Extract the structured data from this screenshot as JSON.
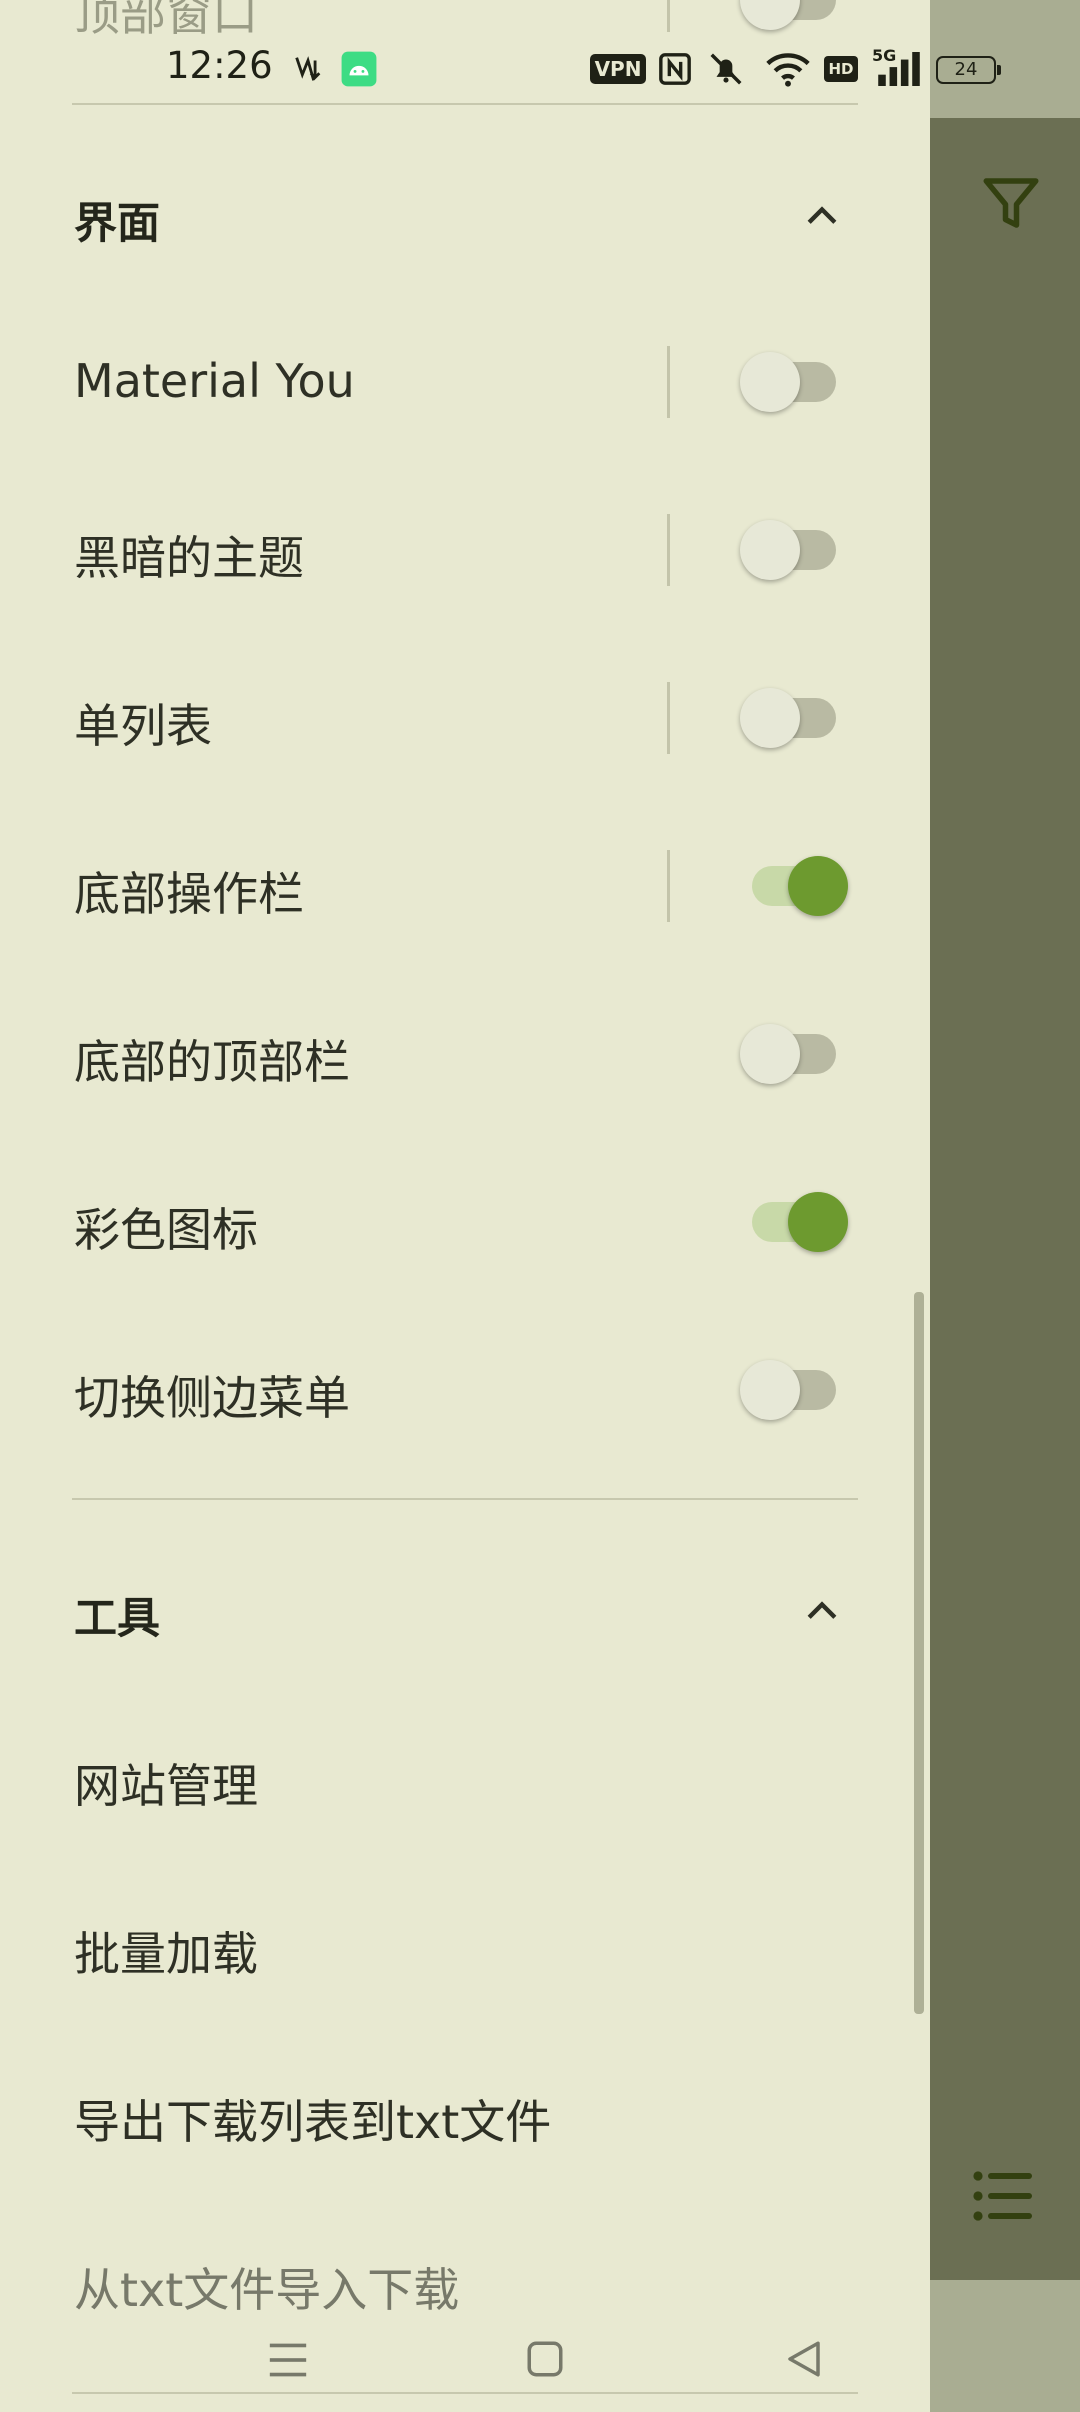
{
  "status_bar": {
    "time": "12:26",
    "vpn_badge": "VPN",
    "hd_badge": "HD",
    "network": "5G",
    "battery": "24"
  },
  "partial_top_label": "顶部窗口",
  "sections": {
    "interface": {
      "title": "界面",
      "items": [
        {
          "label": "Material You",
          "on": false
        },
        {
          "label": "黑暗的主题",
          "on": false
        },
        {
          "label": "单列表",
          "on": false
        },
        {
          "label": "底部操作栏",
          "on": true
        },
        {
          "label": "底部的顶部栏",
          "on": false
        },
        {
          "label": "彩色图标",
          "on": true
        },
        {
          "label": "切换侧边菜单",
          "on": false
        }
      ]
    },
    "tools": {
      "title": "工具",
      "items": [
        {
          "label": "网站管理"
        },
        {
          "label": "批量加载"
        },
        {
          "label": "导出下载列表到txt文件"
        },
        {
          "label": "从txt文件导入下载"
        }
      ]
    }
  },
  "icons": {
    "expand": "chevron-up-icon",
    "filter": "filter-icon",
    "list": "list-icon",
    "nav_menu": "menu-icon",
    "nav_home": "home-square-icon",
    "nav_back": "back-triangle-icon"
  },
  "colors": {
    "drawer_bg": "#e8e9d1",
    "scrim": "#6b6f53",
    "accent": "#6d9a2f",
    "text": "#2e3025"
  }
}
